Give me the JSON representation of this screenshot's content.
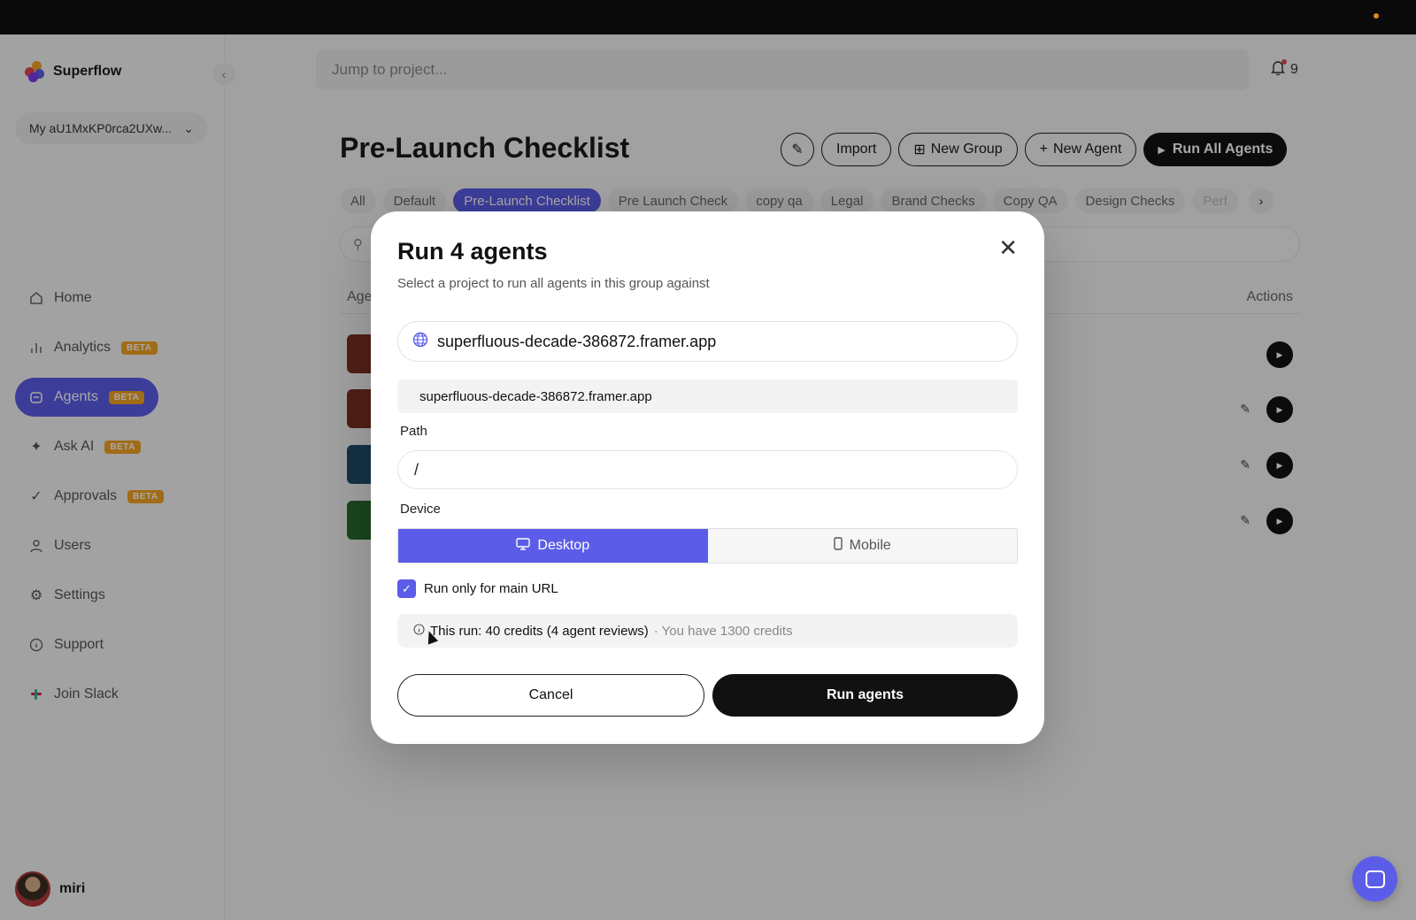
{
  "app": {
    "name": "Superflow"
  },
  "sidebar": {
    "workspace": "My aU1MxKP0rca2UXw...",
    "items": [
      {
        "label": "Home",
        "icon": "home-icon",
        "badge": ""
      },
      {
        "label": "Analytics",
        "icon": "chart-icon",
        "badge": "BETA"
      },
      {
        "label": "Agents",
        "icon": "agents-icon",
        "badge": "BETA",
        "active": true
      },
      {
        "label": "Ask AI",
        "icon": "sparkle-icon",
        "badge": "BETA"
      },
      {
        "label": "Approvals",
        "icon": "check-icon",
        "badge": "BETA"
      },
      {
        "label": "Users",
        "icon": "user-icon",
        "badge": ""
      },
      {
        "label": "Settings",
        "icon": "gear-icon",
        "badge": ""
      },
      {
        "label": "Support",
        "icon": "info-icon",
        "badge": ""
      },
      {
        "label": "Join Slack",
        "icon": "slack-icon",
        "badge": ""
      }
    ],
    "user": "miri"
  },
  "header": {
    "jump_placeholder": "Jump to project...",
    "notifications": "9",
    "page_title": "Pre-Launch Checklist",
    "import_label": "Import",
    "new_group_label": "New Group",
    "new_agent_label": "New Agent",
    "run_all_label": "Run All Agents"
  },
  "tabs": [
    "All",
    "Default",
    "Pre-Launch Checklist",
    "Pre Launch Check",
    "copy qa",
    "Legal",
    "Brand Checks",
    "Copy QA",
    "Design Checks",
    "Perf"
  ],
  "table": {
    "col_agent": "Age",
    "col_actions": "Actions"
  },
  "modal": {
    "title": "Run 4 agents",
    "subtitle": "Select a project to run all agents in this group against",
    "project_value": "superfluous-decade-386872.framer.app",
    "dropdown_option": "superfluous-decade-386872.framer.app",
    "path_label": "Path",
    "path_value": "/",
    "device_label": "Device",
    "device_desktop": "Desktop",
    "device_mobile": "Mobile",
    "checkbox_label": "Run only for main URL",
    "credits_main": "This run: 40 credits (4 agent reviews)",
    "credits_extra": "· You have 1300 credits",
    "cancel_label": "Cancel",
    "run_label": "Run agents"
  },
  "colors": {
    "accent": "#5b5de8",
    "badge": "#f5a524",
    "dark": "#111111"
  }
}
